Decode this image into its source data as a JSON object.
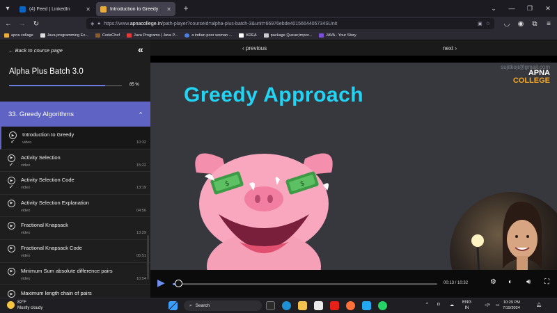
{
  "browser": {
    "tabs": [
      {
        "title": "(4) Feed | LinkedIn",
        "icon": "linkedin-icon",
        "active": false
      },
      {
        "title": "Introduction to Greedy",
        "icon": "apnacollege-icon",
        "active": true
      }
    ],
    "url_prefix": "https://www.",
    "url_host": "apnacollege.in",
    "url_rest": "/path-player?courseid=alpha-plus-batch-3&unit=66976ebde4015664405734SUnit",
    "bookmarks": [
      "apna collage",
      "Java programming Ex...",
      "CodeChef",
      "Java Programs | Java P...",
      "a indian poor woman ...",
      "KREA",
      "package Queue;impor...",
      "JAVA - Your Story"
    ]
  },
  "sidebar": {
    "back_label": "Back to course page",
    "course_title": "Alpha Plus Batch 3.0",
    "progress_pct_label": "85 %",
    "progress_value": 0.85,
    "section_title": "33. Greedy Algorithms",
    "lessons": [
      {
        "title": "Introduction to Greedy",
        "type": "video",
        "duration": "10:32",
        "done": true
      },
      {
        "title": "Activity Selection",
        "type": "video",
        "duration": "15:22",
        "done": true
      },
      {
        "title": "Activity Selection Code",
        "type": "video",
        "duration": "13:19",
        "done": true
      },
      {
        "title": "Activity Selection Explanation",
        "type": "video",
        "duration": "04:56",
        "done": false
      },
      {
        "title": "Fractional Knapsack",
        "type": "video",
        "duration": "13:29",
        "done": false
      },
      {
        "title": "Fractional Knapsack Code",
        "type": "video",
        "duration": "05:51",
        "done": false
      },
      {
        "title": "Minimum Sum absolute difference pairs",
        "type": "video",
        "duration": "10:54",
        "done": false
      },
      {
        "title": "Maximum length chain of pairs",
        "type": "video",
        "duration": "",
        "done": false
      }
    ]
  },
  "player": {
    "prev_label": "‹ previous",
    "next_label": "next ›",
    "slide_title": "Greedy Approach",
    "watermark": "sujitkoji@gmail.com",
    "logo_line1": "APNA",
    "logo_line2": "COLLEGE",
    "time": "00:13 / 10:32",
    "played_fraction": 0.02
  },
  "taskbar": {
    "temp": "82°F",
    "weather": "Mostly cloudy",
    "search_placeholder": "Search",
    "lang1": "ENG",
    "lang2": "IN",
    "time": "10:29 PM",
    "date": "7/19/2024"
  },
  "colors": {
    "accent": "#5e63c4",
    "title_cyan": "#22d3f3",
    "player_blue": "#6c8ff0"
  }
}
